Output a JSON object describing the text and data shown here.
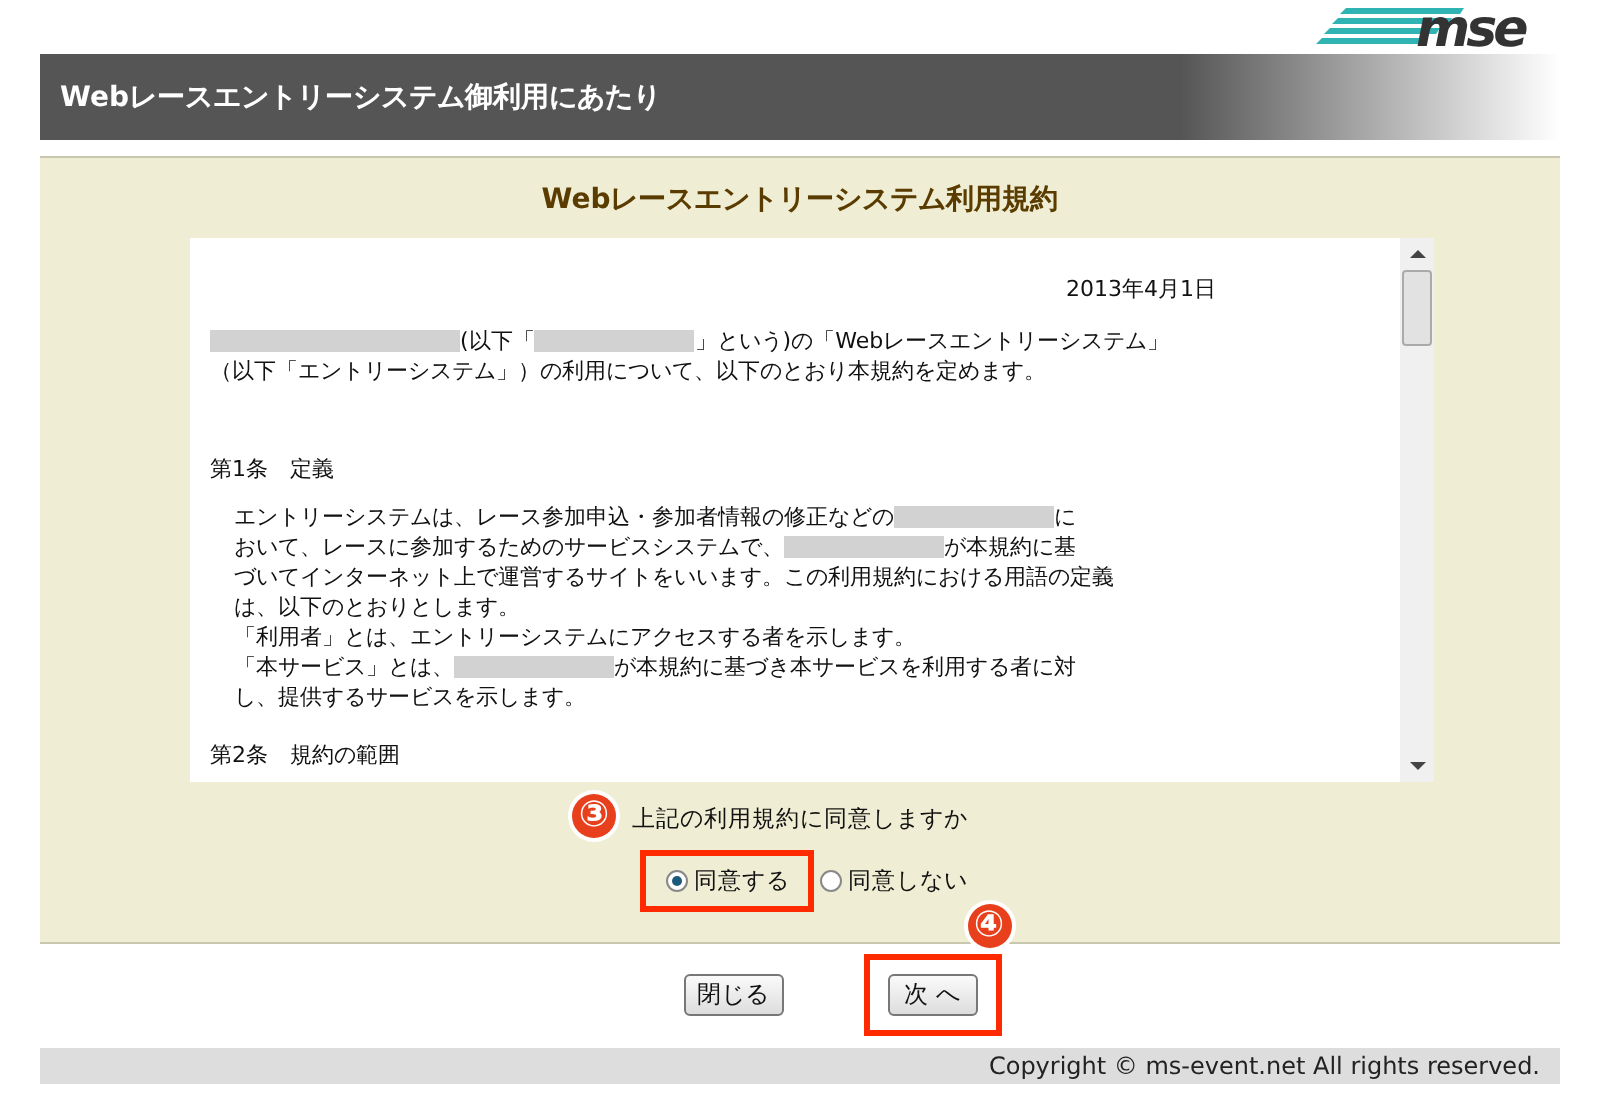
{
  "logo": {
    "text": "mse"
  },
  "header": {
    "title": "Webレースエントリーシステム御利用にあたり"
  },
  "terms": {
    "title": "Webレースエントリーシステム利用規約",
    "date": "2013年4月1日",
    "blocks": [
      {
        "kind": "paragraph",
        "lines": [
          [
            {
              "kind": "redacted"
            },
            {
              "kind": "text",
              "text": "(以下「"
            },
            {
              "kind": "redacted"
            },
            {
              "kind": "text",
              "text": "」という)の「Webレースエントリーシステム」"
            }
          ],
          [
            {
              "kind": "text",
              "text": "（以下「エントリーシステム」）の利用について、以下のとおり本規約を定めます。"
            }
          ]
        ]
      },
      {
        "kind": "heading",
        "text": "第1条　定義"
      },
      {
        "kind": "indented",
        "lines": [
          [
            {
              "kind": "text",
              "text": "エントリーシステムは、レース参加申込・参加者情報の修正などの"
            },
            {
              "kind": "redacted"
            },
            {
              "kind": "text",
              "text": "に"
            }
          ],
          [
            {
              "kind": "text",
              "text": "おいて、レースに参加するためのサービスシステムで、"
            },
            {
              "kind": "redacted"
            },
            {
              "kind": "text",
              "text": "が本規約に基"
            }
          ],
          [
            {
              "kind": "text",
              "text": "づいてインターネット上で運営するサイトをいいます。この利用規約における用語の定義"
            }
          ],
          [
            {
              "kind": "text",
              "text": "は、以下のとおりとします。"
            }
          ],
          [
            {
              "kind": "text",
              "text": "「利用者」とは、エントリーシステムにアクセスする者を示します。"
            }
          ],
          [
            {
              "kind": "text",
              "text": "「本サービス」とは、"
            },
            {
              "kind": "redacted"
            },
            {
              "kind": "text",
              "text": "が本規約に基づき本サービスを利用する者に対"
            }
          ],
          [
            {
              "kind": "text",
              "text": "し、提供するサービスを示します。"
            }
          ]
        ]
      },
      {
        "kind": "heading",
        "text": "第2条　規約の範囲"
      }
    ]
  },
  "agreement": {
    "question": "上記の利用規約に同意しますか",
    "callout": "③",
    "options": [
      {
        "label": "同意する",
        "selected": true,
        "highlighted": true
      },
      {
        "label": "同意しない",
        "selected": false,
        "highlighted": false
      }
    ]
  },
  "buttons": [
    {
      "label": "閉じる",
      "highlighted": false
    },
    {
      "label": "次 へ",
      "highlighted": true,
      "callout": "④"
    }
  ],
  "footer": {
    "text": "Copyright © ms-event.net All rights reserved."
  }
}
